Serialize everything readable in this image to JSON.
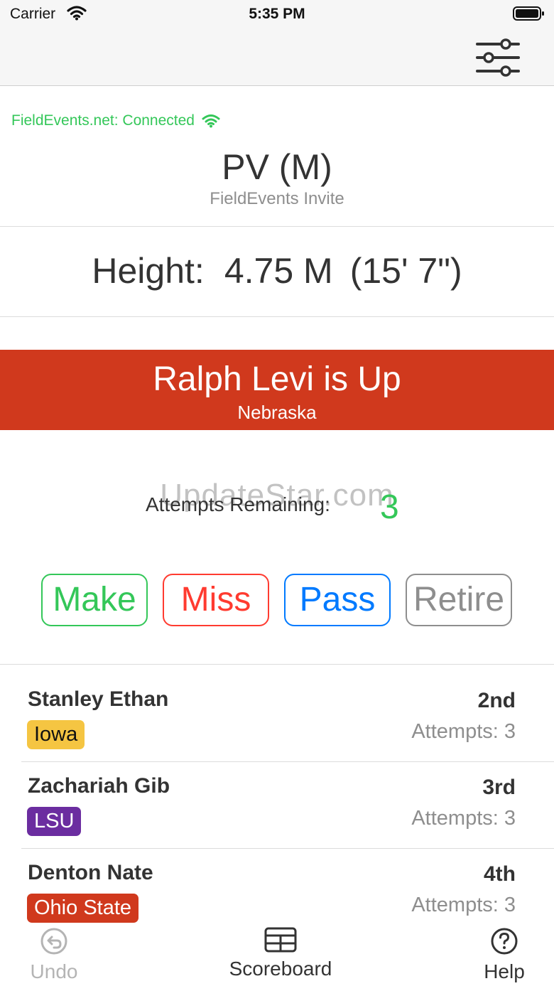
{
  "status_bar": {
    "carrier": "Carrier",
    "time": "5:35 PM"
  },
  "nav": {
    "settings_icon": "sliders-icon"
  },
  "connection": {
    "text": "FieldEvents.net: Connected",
    "icon": "wifi-icon",
    "color": "#34c759"
  },
  "event": {
    "title": "PV (M)",
    "subtitle": "FieldEvents Invite"
  },
  "height": {
    "label": "Height:",
    "metric": "4.75 M",
    "imperial": "(15' 7\")"
  },
  "up": {
    "title": "Ralph Levi is Up",
    "team": "Nebraska",
    "color": "#d0391d"
  },
  "watermark": "UpdateStar.com",
  "attempts": {
    "label": "Attempts Remaining:",
    "value": "3"
  },
  "actions": {
    "make": "Make",
    "miss": "Miss",
    "pass": "Pass",
    "retire": "Retire"
  },
  "athletes": [
    {
      "name": "Stanley Ethan",
      "team": "Iowa",
      "team_bg": "#f5c542",
      "team_fg": "#111111",
      "place": "2nd",
      "attempts": "Attempts: 3"
    },
    {
      "name": "Zachariah Gib",
      "team": "LSU",
      "team_bg": "#6b2da0",
      "team_fg": "#ffffff",
      "place": "3rd",
      "attempts": "Attempts: 3"
    },
    {
      "name": "Denton Nate",
      "team": "Ohio State",
      "team_bg": "#d0391d",
      "team_fg": "#ffffff",
      "place": "4th",
      "attempts": "Attempts: 3"
    }
  ],
  "tabs": {
    "undo": "Undo",
    "scoreboard": "Scoreboard",
    "help": "Help"
  }
}
